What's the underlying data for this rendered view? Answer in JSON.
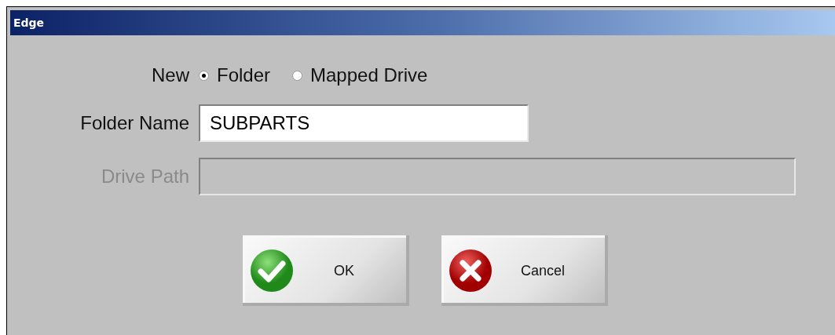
{
  "window": {
    "title": "Edge"
  },
  "new_label": "New",
  "options": [
    {
      "label": "Folder",
      "selected": true
    },
    {
      "label": "Mapped Drive",
      "selected": false
    }
  ],
  "fields": [
    {
      "label": "Folder Name",
      "value": "SUBPARTS",
      "disabled": false
    },
    {
      "label": "Drive Path",
      "disabled": true
    }
  ],
  "buttons": [
    {
      "label": "OK",
      "kind": "ok"
    },
    {
      "label": "Cancel",
      "kind": "cancel"
    }
  ]
}
